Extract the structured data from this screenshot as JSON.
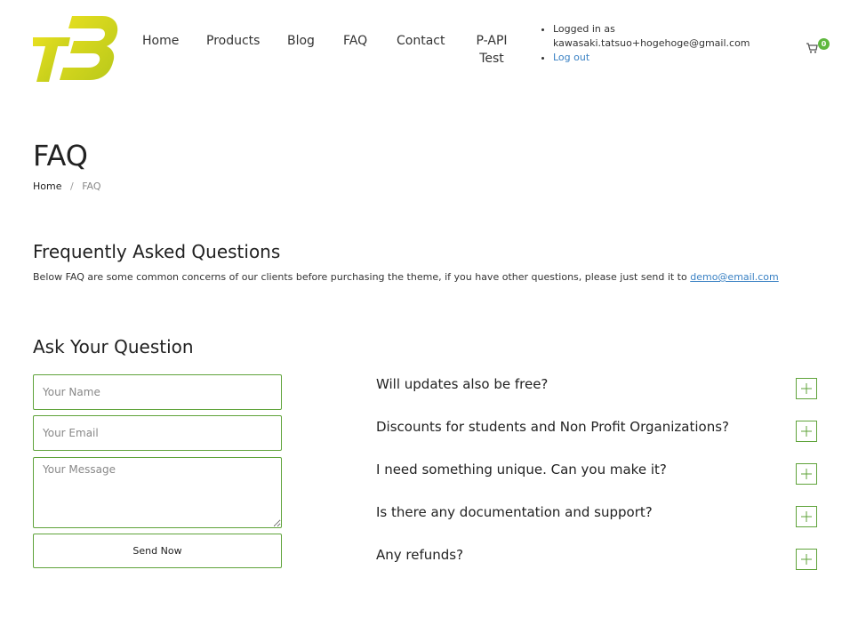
{
  "header": {
    "logo_text": "TB",
    "nav": [
      {
        "label": "Home"
      },
      {
        "label": "Products"
      },
      {
        "label": "Blog"
      },
      {
        "label": "FAQ"
      },
      {
        "label": "Contact"
      },
      {
        "label_line1": "P-API",
        "label_line2": "Test"
      }
    ],
    "account": {
      "logged_in_label": "Logged in as",
      "email": "kawasaki.tatsuo+hogehoge@gmail.com",
      "logout_label": "Log out"
    },
    "cart": {
      "icon": "cart-icon",
      "count": "0"
    }
  },
  "page": {
    "title": "FAQ",
    "breadcrumb": {
      "home": "Home",
      "separator": "/",
      "current": "FAQ"
    }
  },
  "faq_section": {
    "title": "Frequently Asked Questions",
    "intro": "Below FAQ are some common concerns of our clients before purchasing the theme, if you have other questions, please just send it to",
    "email_link": "demo@email.com"
  },
  "question_form": {
    "title": "Ask Your Question",
    "name_placeholder": "Your Name",
    "email_placeholder": "Your Email",
    "message_placeholder": "Your Message",
    "submit_label": "Send Now"
  },
  "faqs": [
    {
      "question": "Will updates also be free?"
    },
    {
      "question": "Discounts for students and Non Profit Organizations?"
    },
    {
      "question": "I need something unique. Can you make it?"
    },
    {
      "question": "Is there any documentation and support?"
    },
    {
      "question": "Any refunds?"
    }
  ],
  "colors": {
    "accent_green": "#5fa33a",
    "logo_yellow": "#d4d41e",
    "link_blue": "#3b82c4",
    "badge_green": "#5fb83e"
  }
}
